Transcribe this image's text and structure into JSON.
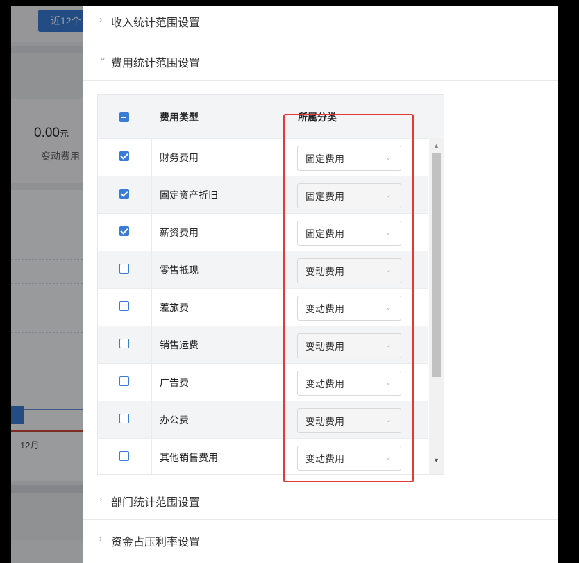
{
  "background": {
    "range_button": "近12个",
    "kpi_value": "0.00",
    "kpi_unit": "元",
    "kpi_label": "变动费用",
    "x_label": "12月"
  },
  "drawer": {
    "sections": {
      "income": {
        "title": "收入统计范围设置",
        "expanded": false
      },
      "expense": {
        "title": "费用统计范围设置",
        "expanded": true
      },
      "department": {
        "title": "部门统计范围设置",
        "expanded": false
      },
      "capital": {
        "title": "资金占压利率设置",
        "expanded": false
      }
    },
    "table": {
      "header": {
        "type": "费用类型",
        "category": "所属分类"
      },
      "rows": [
        {
          "name": "财务费用",
          "checked": true,
          "category": "固定费用"
        },
        {
          "name": "固定资产折旧",
          "checked": true,
          "category": "固定费用"
        },
        {
          "name": "薪资费用",
          "checked": true,
          "category": "固定费用"
        },
        {
          "name": "零售抵现",
          "checked": false,
          "category": "变动费用"
        },
        {
          "name": "差旅费",
          "checked": false,
          "category": "变动费用"
        },
        {
          "name": "销售运费",
          "checked": false,
          "category": "变动费用"
        },
        {
          "name": "广告费",
          "checked": false,
          "category": "变动费用"
        },
        {
          "name": "办公费",
          "checked": false,
          "category": "变动费用"
        },
        {
          "name": "其他销售费用",
          "checked": false,
          "category": "变动费用"
        }
      ]
    }
  },
  "icons": {
    "collapsed_chevron": "›",
    "expanded_chevron": "⌄",
    "select_chevron": "⌄",
    "scroll_up": "▲",
    "scroll_down": "▼"
  },
  "colors": {
    "accent": "#3a7bd5",
    "highlight": "#e53935"
  }
}
